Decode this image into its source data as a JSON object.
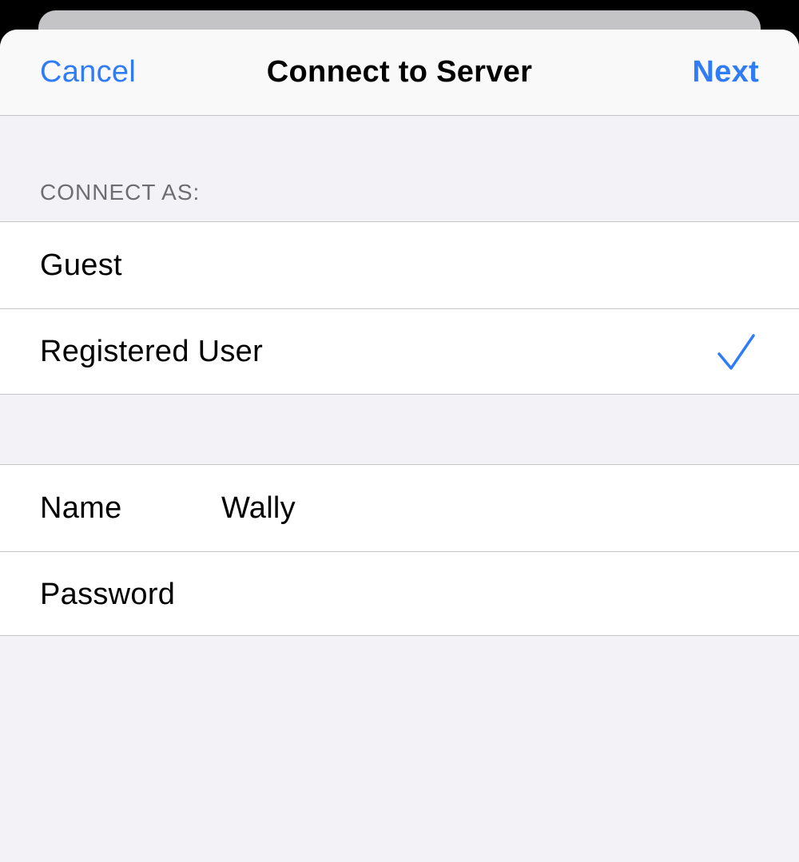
{
  "navbar": {
    "cancel_label": "Cancel",
    "title": "Connect to Server",
    "next_label": "Next"
  },
  "connect_as": {
    "header": "CONNECT AS:",
    "options": [
      {
        "label": "Guest",
        "selected": false
      },
      {
        "label": "Registered User",
        "selected": true
      }
    ]
  },
  "credentials": {
    "name_label": "Name",
    "name_value": "Wally",
    "password_label": "Password",
    "password_value": ""
  },
  "icons": {
    "checkmark": "checkmark-icon"
  },
  "colors": {
    "accent": "#2f7cf6",
    "background": "#f2f2f7",
    "separator": "#c6c6c8",
    "secondary_text": "#6d6d72"
  }
}
